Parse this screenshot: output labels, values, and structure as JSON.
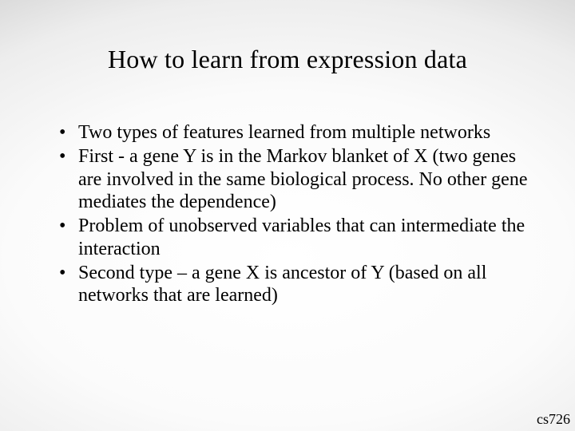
{
  "title": "How to learn from expression data",
  "bullets": [
    "Two types of features learned from multiple networks",
    "First -  a gene Y is in the Markov blanket of X (two genes are involved in the same biological process. No other gene mediates the dependence)",
    "Problem of unobserved variables that can intermediate the interaction",
    "Second type – a gene X is ancestor of Y (based on all networks that are learned)"
  ],
  "footer": "cs726"
}
